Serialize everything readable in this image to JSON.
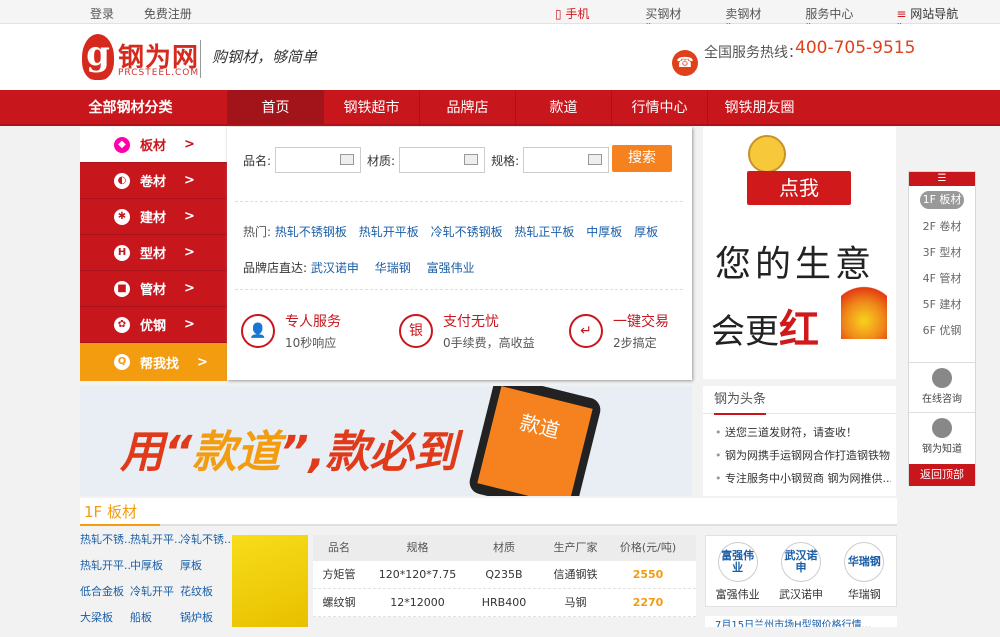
{
  "topbar": {
    "login": "登录",
    "register": "免费注册",
    "app": "手机APP",
    "buy": "买钢材",
    "sell": "卖钢材",
    "service": "服务中心",
    "sitenav": "网站导航"
  },
  "header": {
    "logo_letter": "g",
    "logo_name": "钢为网",
    "logo_en": "PRCSTEEL.COM",
    "slogan": "购钢材，够简单",
    "hotline_label": "全国服务热线：",
    "hotline_number": "400-705-9515"
  },
  "nav": {
    "all_categories": "全部钢材分类",
    "items": [
      "首页",
      "钢铁超市",
      "品牌店",
      "款道",
      "行情中心",
      "钢铁朋友圈"
    ]
  },
  "categories": [
    {
      "label": "板材",
      "icon": "◆"
    },
    {
      "label": "卷材",
      "icon": "◐"
    },
    {
      "label": "建材",
      "icon": "✱"
    },
    {
      "label": "型材",
      "icon": "H"
    },
    {
      "label": "管材",
      "icon": "■"
    },
    {
      "label": "优钢",
      "icon": "✿"
    },
    {
      "label": "帮我找",
      "icon": "Q"
    }
  ],
  "search": {
    "name_label": "品名:",
    "material_label": "材质:",
    "spec_label": "规格:",
    "button": "搜索"
  },
  "hot": {
    "label": "热门:",
    "items": [
      "热轧不锈钢板",
      "热轧开平板",
      "冷轧不锈钢板",
      "热轧正平板",
      "中厚板",
      "厚板"
    ]
  },
  "brand_direct": {
    "label": "品牌店直达:",
    "items": [
      "武汉诺申",
      "华瑞钢",
      "富强伟业"
    ]
  },
  "features": [
    {
      "title": "专人服务",
      "desc": "10秒响应",
      "icon": "👤"
    },
    {
      "title": "支付无忧",
      "desc": "0手续费，高收益",
      "icon": "银"
    },
    {
      "title": "一键交易",
      "desc": "2步搞定",
      "icon": "↵"
    }
  ],
  "ad": {
    "click": "点我",
    "line1": "您的生意",
    "line2a": "会更",
    "line2b": "红"
  },
  "banner": {
    "quote_open": "用“",
    "keyword": "款道",
    "rest": "”,款必到",
    "screen": "款道"
  },
  "news": {
    "title": "钢为头条",
    "items": [
      "送您三道发财符，请查收！",
      "钢为网携手运钢网合作打造钢铁物...",
      "专注服务中小钢贸商 钢为网推供..."
    ]
  },
  "floor": {
    "title": "1F 板材",
    "links": [
      [
        "热轧不锈...",
        "热轧开平...",
        "冷轧不锈..."
      ],
      [
        "热轧开平...",
        "中厚板",
        "厚板"
      ],
      [
        "低合金板",
        "冷轧开平",
        "花纹板"
      ],
      [
        "大梁板",
        "船板",
        "锅炉板"
      ]
    ],
    "table_headers": [
      "品名",
      "规格",
      "材质",
      "生产厂家",
      "价格(元/吨)"
    ],
    "rows": [
      [
        "方矩管",
        "120*120*7.75",
        "Q235B",
        "信通钢铁",
        "2550"
      ],
      [
        "螺纹钢",
        "12*12000",
        "HRB400",
        "马钢",
        "2270"
      ]
    ],
    "brands": [
      {
        "logo": "富强伟业",
        "name": "富强伟业"
      },
      {
        "logo": "武汉诺申",
        "name": "武汉诺申"
      },
      {
        "logo": "华瑞钢",
        "name": "华瑞钢"
      }
    ],
    "ticker": "7月15日兰州市场H型钢价格行情..."
  },
  "floornav": {
    "top": "☰",
    "items": [
      "1F 板材",
      "2F 卷材",
      "3F 型材",
      "4F 管材",
      "5F 建材",
      "6F 优钢"
    ],
    "online": "在线咨询",
    "know": "钢为知道",
    "back": "返回顶部"
  }
}
